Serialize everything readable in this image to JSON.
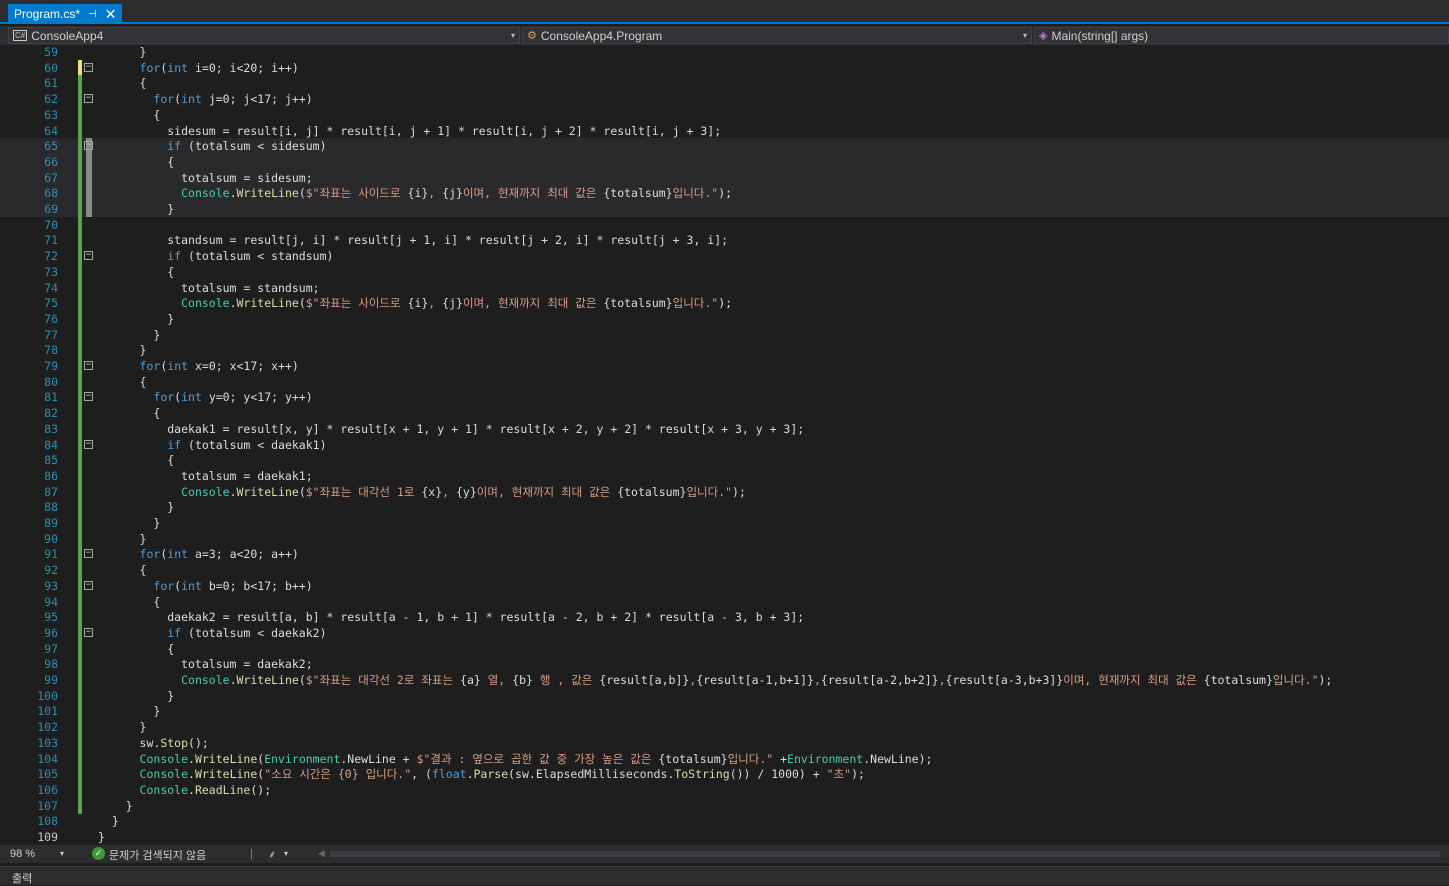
{
  "tab": {
    "title": "Program.cs*",
    "pin_glyph": "⊣",
    "close_glyph": "✕"
  },
  "navbar": {
    "project": "ConsoleApp4",
    "type": "ConsoleApp4.Program",
    "member": "Main(string[] args)"
  },
  "icons": {
    "project": "csharp-project-icon",
    "type": "class-icon",
    "member": "method-icon",
    "fold": "collapse-icon",
    "status_ok": "check-circle-icon",
    "brush": "code-cleanup-icon"
  },
  "code_lines": [
    {
      "n": "59",
      "html": "      }"
    },
    {
      "n": "60",
      "html": "      <span class=\"kw\">for</span>(<span class=\"kw\">int</span> i=0; i&lt;20; i++)"
    },
    {
      "n": "61",
      "html": "      {"
    },
    {
      "n": "62",
      "html": "        <span class=\"kw\">for</span>(<span class=\"kw\">int</span> j=0; j&lt;17; j++)"
    },
    {
      "n": "63",
      "html": "        {"
    },
    {
      "n": "64",
      "html": "          sidesum = result[i, j] * result[i, j + 1] * result[i, j + 2] * result[i, j + 3];"
    },
    {
      "n": "65",
      "html": "          <span class=\"kw\">if</span> (totalsum &lt; sidesum)"
    },
    {
      "n": "66",
      "html": "          {"
    },
    {
      "n": "67",
      "html": "            totalsum = sidesum;"
    },
    {
      "n": "68",
      "html": "            <span class=\"ty\">Console</span>.<span class=\"fn\">WriteLine</span>(<span class=\"st\">$\"좌표는 사이드로 </span>{i}<span class=\"st\">, </span>{j}<span class=\"st\">이며, 현재까지 최대 값은 </span>{totalsum}<span class=\"st\">입니다.\"</span>);"
    },
    {
      "n": "69",
      "html": "          }"
    },
    {
      "n": "70",
      "html": ""
    },
    {
      "n": "71",
      "html": "          standsum = result[j, i] * result[j + 1, i] * result[j + 2, i] * result[j + 3, i];"
    },
    {
      "n": "72",
      "html": "          <span class=\"kw\">if</span> (totalsum &lt; standsum)"
    },
    {
      "n": "73",
      "html": "          {"
    },
    {
      "n": "74",
      "html": "            totalsum = standsum;"
    },
    {
      "n": "75",
      "html": "            <span class=\"ty\">Console</span>.<span class=\"fn\">WriteLine</span>(<span class=\"st\">$\"좌표는 사이드로 </span>{i}<span class=\"st\">, </span>{j}<span class=\"st\">이며, 현재까지 최대 값은 </span>{totalsum}<span class=\"st\">입니다.\"</span>);"
    },
    {
      "n": "76",
      "html": "          }"
    },
    {
      "n": "77",
      "html": "        }"
    },
    {
      "n": "78",
      "html": "      }"
    },
    {
      "n": "79",
      "html": "      <span class=\"kw\">for</span>(<span class=\"kw\">int</span> x=0; x&lt;17; x++)"
    },
    {
      "n": "80",
      "html": "      {"
    },
    {
      "n": "81",
      "html": "        <span class=\"kw\">for</span>(<span class=\"kw\">int</span> y=0; y&lt;17; y++)"
    },
    {
      "n": "82",
      "html": "        {"
    },
    {
      "n": "83",
      "html": "          daekak1 = result[x, y] * result[x + 1, y + 1] * result[x + 2, y + 2] * result[x + 3, y + 3];"
    },
    {
      "n": "84",
      "html": "          <span class=\"kw\">if</span> (totalsum &lt; daekak1)"
    },
    {
      "n": "85",
      "html": "          {"
    },
    {
      "n": "86",
      "html": "            totalsum = daekak1;"
    },
    {
      "n": "87",
      "html": "            <span class=\"ty\">Console</span>.<span class=\"fn\">WriteLine</span>(<span class=\"st\">$\"좌표는 대각선 1로 </span>{x}<span class=\"st\">, </span>{y}<span class=\"st\">이며, 현재까지 최대 값은 </span>{totalsum}<span class=\"st\">입니다.\"</span>);"
    },
    {
      "n": "88",
      "html": "          }"
    },
    {
      "n": "89",
      "html": "        }"
    },
    {
      "n": "90",
      "html": "      }"
    },
    {
      "n": "91",
      "html": "      <span class=\"kw\">for</span>(<span class=\"kw\">int</span> a=3; a&lt;20; a++)"
    },
    {
      "n": "92",
      "html": "      {"
    },
    {
      "n": "93",
      "html": "        <span class=\"kw\">for</span>(<span class=\"kw\">int</span> b=0; b&lt;17; b++)"
    },
    {
      "n": "94",
      "html": "        {"
    },
    {
      "n": "95",
      "html": "          daekak2 = result[a, b] * result[a - 1, b + 1] * result[a - 2, b + 2] * result[a - 3, b + 3];"
    },
    {
      "n": "96",
      "html": "          <span class=\"kw\">if</span> (totalsum &lt; daekak2)"
    },
    {
      "n": "97",
      "html": "          {"
    },
    {
      "n": "98",
      "html": "            totalsum = daekak2;"
    },
    {
      "n": "99",
      "html": "            <span class=\"ty\">Console</span>.<span class=\"fn\">WriteLine</span>(<span class=\"st\">$\"좌표는 대각선 2로 좌표는 </span>{a}<span class=\"st\"> 열, </span>{b}<span class=\"st\"> 행 , 값은 </span>{result[a,b]}<span class=\"st\">,</span>{result[a-1,b+1]}<span class=\"st\">,</span>{result[a-2,b+2]}<span class=\"st\">,</span>{result[a-3,b+3]}<span class=\"st\">이며, 현재까지 최대 값은 </span>{totalsum}<span class=\"st\">입니다.\"</span>);"
    },
    {
      "n": "100",
      "html": "          }"
    },
    {
      "n": "101",
      "html": "        }"
    },
    {
      "n": "102",
      "html": "      }"
    },
    {
      "n": "103",
      "html": "      sw.<span class=\"fn\">Stop</span>();"
    },
    {
      "n": "104",
      "html": "      <span class=\"ty\">Console</span>.<span class=\"fn\">WriteLine</span>(<span class=\"ty\">Environment</span>.NewLine + <span class=\"st\">$\"결과 : 옆으로 곱한 값 중 가장 높은 값은 </span>{totalsum}<span class=\"st\">입니다.\"</span> +<span class=\"ty\">Environment</span>.NewLine);"
    },
    {
      "n": "105",
      "html": "      <span class=\"ty\">Console</span>.<span class=\"fn\">WriteLine</span>(<span class=\"st\">\"소요 시간은 {0} 입니다.\"</span>, (<span class=\"kw\">float</span>.<span class=\"fn\">Parse</span>(sw.ElapsedMilliseconds.<span class=\"fn\">ToString</span>()) / 1000) + <span class=\"st\">\"초\"</span>);"
    },
    {
      "n": "106",
      "html": "      <span class=\"ty\">Console</span>.<span class=\"fn\">ReadLine</span>();"
    },
    {
      "n": "107",
      "html": "    }"
    },
    {
      "n": "108",
      "html": "  }"
    },
    {
      "n": "109",
      "html": "}"
    }
  ],
  "status": {
    "zoom": "98 %",
    "issues": "문제가 검색되지 않음",
    "separator": "|",
    "caret_glyph": "▾",
    "scroll_left_glyph": "◀"
  },
  "output_panel": {
    "title": "출력"
  },
  "colors": {
    "accent": "#007acc",
    "editor_bg": "#1e1e1e",
    "keyword": "#569cd6",
    "type": "#4ec9b0",
    "string": "#d69d85",
    "change_bar": "#57a64a"
  }
}
